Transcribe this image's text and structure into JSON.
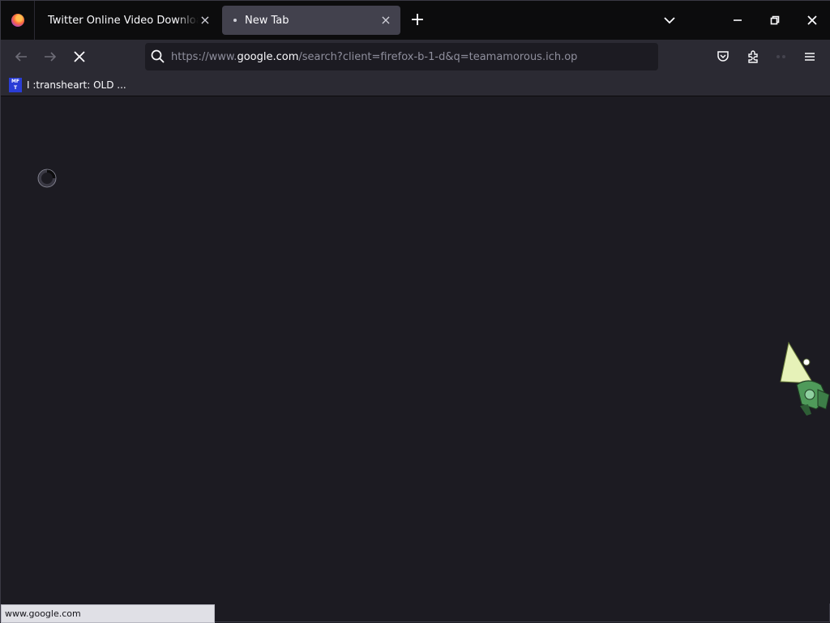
{
  "window": {
    "title": "New Tab"
  },
  "tabs": [
    {
      "label": "Twitter Online Video Downloader",
      "active": false,
      "loading": false
    },
    {
      "label": "New Tab",
      "active": true,
      "loading": true
    }
  ],
  "toolbar": {
    "url_scheme": "https://www.",
    "url_domain": "google.com",
    "url_rest": "/search?client=firefox-b-1-d&q=teamamorous.ich.op"
  },
  "bookmarks": [
    {
      "label": "I :transheart: OLD ...",
      "favicon_text": [
        "MF",
        "T"
      ]
    }
  ],
  "status_bar": {
    "text": "www.google.com"
  },
  "colors": {
    "chrome": "#2b2a33",
    "tabstrip": "#0c0c0d",
    "content": "#1c1b22",
    "active_tab": "#42414d"
  },
  "icons": [
    "firefox-icon",
    "close-icon",
    "plus-icon",
    "chevron-down-icon",
    "minimize-icon",
    "restore-icon",
    "back-icon",
    "forward-icon",
    "stop-icon",
    "search-icon",
    "pocket-icon",
    "extensions-icon",
    "menu-icon",
    "spinner-icon"
  ]
}
